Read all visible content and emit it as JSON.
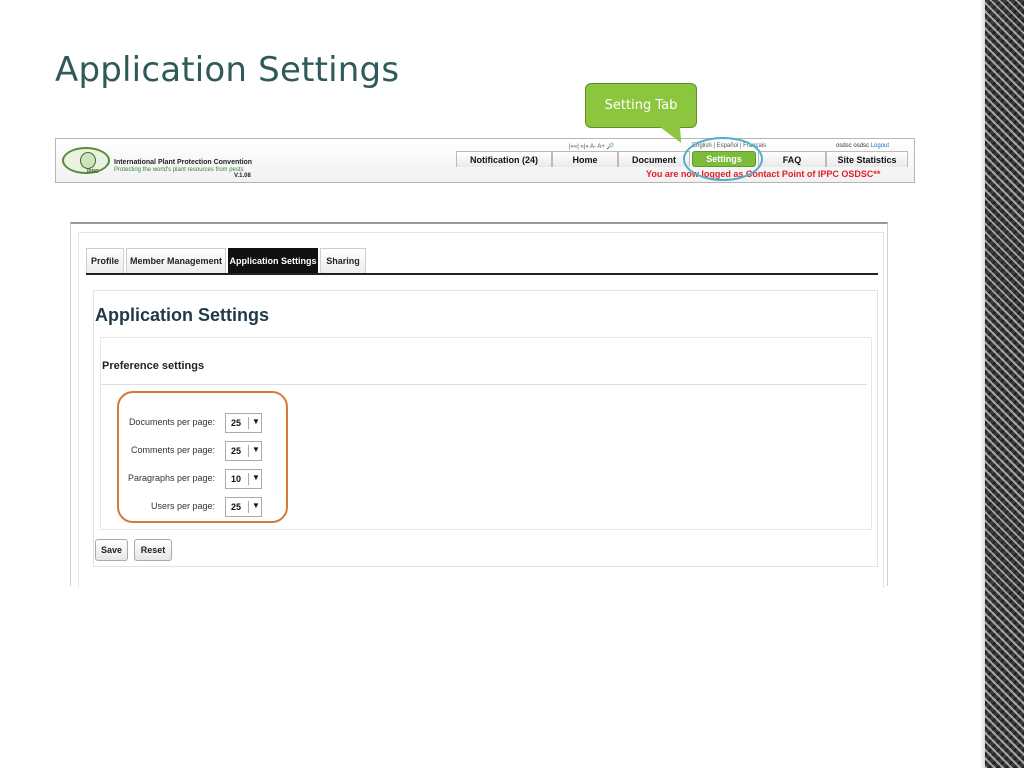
{
  "slide": {
    "title": "Application Settings",
    "callout_text": "Setting Tab"
  },
  "ippc": {
    "org_name": "International Plant Protection Convention",
    "tagline": "Protecting the world's plant resources from pests",
    "version": "V.1.08",
    "logo_text": "IPPC",
    "font_controls": "|««|   «|«   A-   A+   🔎",
    "languages": "English   |   Español   |   Français",
    "user": "osdsc osdsc",
    "logout": "Logout",
    "nav": {
      "notification": "Notification (24)",
      "home": "Home",
      "document": "Document",
      "settings": "Settings",
      "faq": "FAQ",
      "site_statistics": "Site Statistics"
    },
    "status": "You are now logged as Contact Point of IPPC OSDSC**"
  },
  "tabs": [
    "Profile",
    "Member Management",
    "Application Settings",
    "Sharing"
  ],
  "active_tab": "Application Settings",
  "content": {
    "title": "Application Settings",
    "section_heading": "Preference settings",
    "prefs": [
      {
        "label": "Documents per page:",
        "value": "25"
      },
      {
        "label": "Comments per page:",
        "value": "25"
      },
      {
        "label": "Paragraphs per page:",
        "value": "10"
      },
      {
        "label": "Users per page:",
        "value": "25"
      }
    ],
    "save_label": "Save",
    "reset_label": "Reset"
  },
  "colors": {
    "title": "#2e5a5a",
    "callout": "#8cc63f",
    "settings_tab": "#7cbc3a",
    "highlight_oval": "#4fb0c6",
    "orange_box": "#d47a3a",
    "status_red": "#e0202a",
    "active_tab": "#111111"
  }
}
